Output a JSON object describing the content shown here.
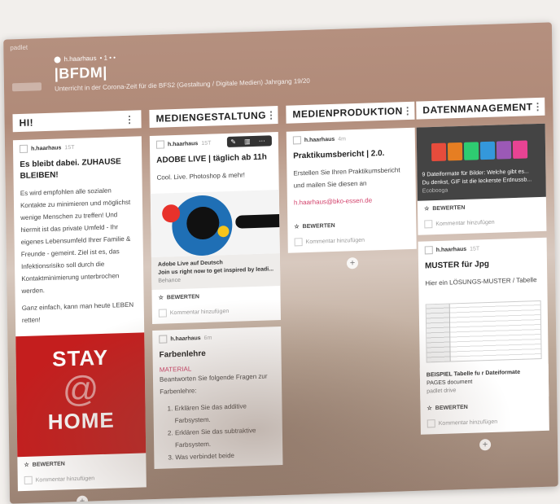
{
  "topbar": {
    "app_name": "padlet"
  },
  "header": {
    "author": "h.haarhaus",
    "author_suffix": "• 1 • •",
    "title": "|BFDM|",
    "subtitle": "Unterricht in der Corona-Zeit für die BFS2 (Gestaltung / Digitale Medien) Jahrgang 19/20"
  },
  "common": {
    "rate_label": "BEWERTEN",
    "comment_label": "Kommentar hinzufügen",
    "add_label": "+",
    "menu": "⋮"
  },
  "columns": [
    {
      "title": "HI!",
      "cards": [
        {
          "author": "h.haarhaus",
          "ago": "15T",
          "title": "Es bleibt dabei. ZUHAUSE BLEIBEN!",
          "body": [
            "Es wird empfohlen alle sozialen Kontakte zu minimieren und möglichst wenige Menschen zu treffen! Und hiermit ist das private Umfeld - Ihr eigenes Lebensumfeld Ihrer Familie & Freunde - gemeint. Ziel ist es, das Infektionsrisiko soll durch die Kontaktminimierung unterbrochen werden.",
            "Ganz einfach, kann man heute LEBEN retten!"
          ],
          "image": {
            "line1": "STAY",
            "line2": "@",
            "line3": "HOME"
          }
        }
      ]
    },
    {
      "title": "MEDIENGESTALTUNG",
      "cards": [
        {
          "author": "h.haarhaus",
          "ago": "15T",
          "toolbar": "✎ ▥ ⋯",
          "title": "ADOBE LIVE | täglich ab 11h",
          "body": "Cool. Live. Photoshop & mehr!",
          "link": {
            "title": "Adobe Live auf Deutsch",
            "desc": "Join us right now to get inspired by leadi...",
            "source": "Behance"
          }
        },
        {
          "author": "h.haarhaus",
          "ago": "6m",
          "title": "Farbenlehre",
          "label": "MATERIAL",
          "body": "Beantworten Sie folgende Fragen zur Farbenlehre:",
          "list": [
            "Erklären Sie das additive Farbsystem.",
            "Erklären Sie das subtraktive Farbsystem.",
            "Was verbindet beide"
          ]
        }
      ]
    },
    {
      "title": "MEDIENPRODUKTION",
      "cards": [
        {
          "author": "h.haarhaus",
          "ago": "4m",
          "title": "Praktikumsbericht | 2.0.",
          "body": "Erstellen Sie Ihren Praktikumsbericht und mailen Sie diesen an",
          "email": "h.haarhaus@bko-essen.de"
        }
      ]
    },
    {
      "title": "DATENMANAGEMENT",
      "cards": [
        {
          "link": {
            "title": "9 Dateiformate für Bilder: Welche gibt es...",
            "desc": "Du denkst, GIF ist die leckerste Erdnussb...",
            "source": "Ecobooga"
          }
        },
        {
          "author": "h.haarhaus",
          "ago": "15T",
          "title": "MUSTER für Jpg",
          "body": "Hier ein LÖSUNGS-MUSTER / Tabelle",
          "link": {
            "title": "BEISPIEL Tabelle fu r Dateiformate",
            "desc": "PAGES document",
            "source": "padlet drive"
          }
        }
      ]
    }
  ]
}
